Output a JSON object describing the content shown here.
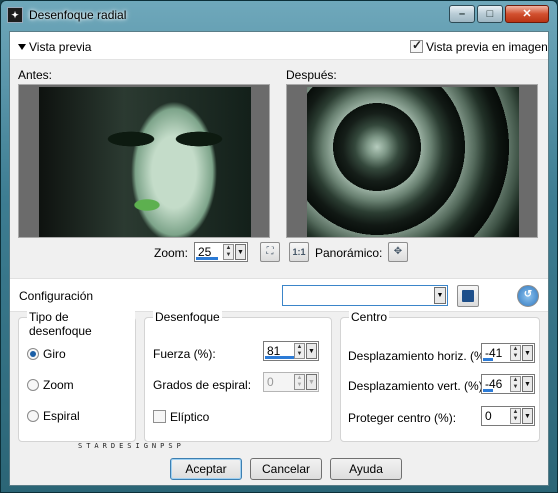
{
  "window": {
    "title": "Desenfoque radial"
  },
  "titlebar_buttons": {
    "minimize": "–",
    "maximize": "□",
    "close": "✕"
  },
  "preview": {
    "toggle_label": "Vista previa",
    "in_image_label": "Vista previa en imagen",
    "in_image_checked": true,
    "before_label": "Antes:",
    "after_label": "Después:"
  },
  "zoom": {
    "label": "Zoom:",
    "value": "25",
    "pan_label": "Panorámico:",
    "one_to_one": "1:1"
  },
  "config": {
    "label": "Configuración",
    "selected": ""
  },
  "blur_type": {
    "title": "Tipo de desenfoque",
    "options": [
      "Giro",
      "Zoom",
      "Espiral"
    ],
    "selected": "Giro"
  },
  "blur": {
    "title": "Desenfoque",
    "strength_label": "Fuerza (%):",
    "strength_value": "81",
    "spiral_label": "Grados de espiral:",
    "spiral_value": "0",
    "elliptic_label": "Elíptico",
    "elliptic_checked": false
  },
  "center": {
    "title": "Centro",
    "h_offset_label": "Desplazamiento horiz. (%):",
    "h_offset_value": "-41",
    "v_offset_label": "Desplazamiento vert. (%):",
    "v_offset_value": "-46",
    "protect_label": "Proteger centro (%):",
    "protect_value": "0"
  },
  "watermark": "STARDESIGNPSP",
  "buttons": {
    "ok": "Aceptar",
    "cancel": "Cancelar",
    "help": "Ayuda"
  }
}
